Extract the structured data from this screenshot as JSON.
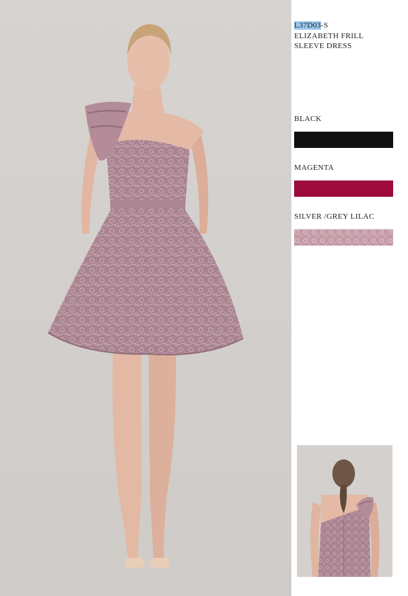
{
  "product": {
    "code_highlighted": "L37D03",
    "code_suffix": "-S",
    "name_line1": "ELIZABETH FRILL",
    "name_line2": "SLEEVE DRESS"
  },
  "colors": [
    {
      "label": "BLACK",
      "hex": "#101010"
    },
    {
      "label": "MAGENTA",
      "hex": "#9c0b3c"
    },
    {
      "label": "SILVER /GREY LILAC",
      "hex": "#c49aa6"
    }
  ],
  "images": {
    "main": "model-front-photo",
    "thumbnail": "model-back-photo"
  }
}
